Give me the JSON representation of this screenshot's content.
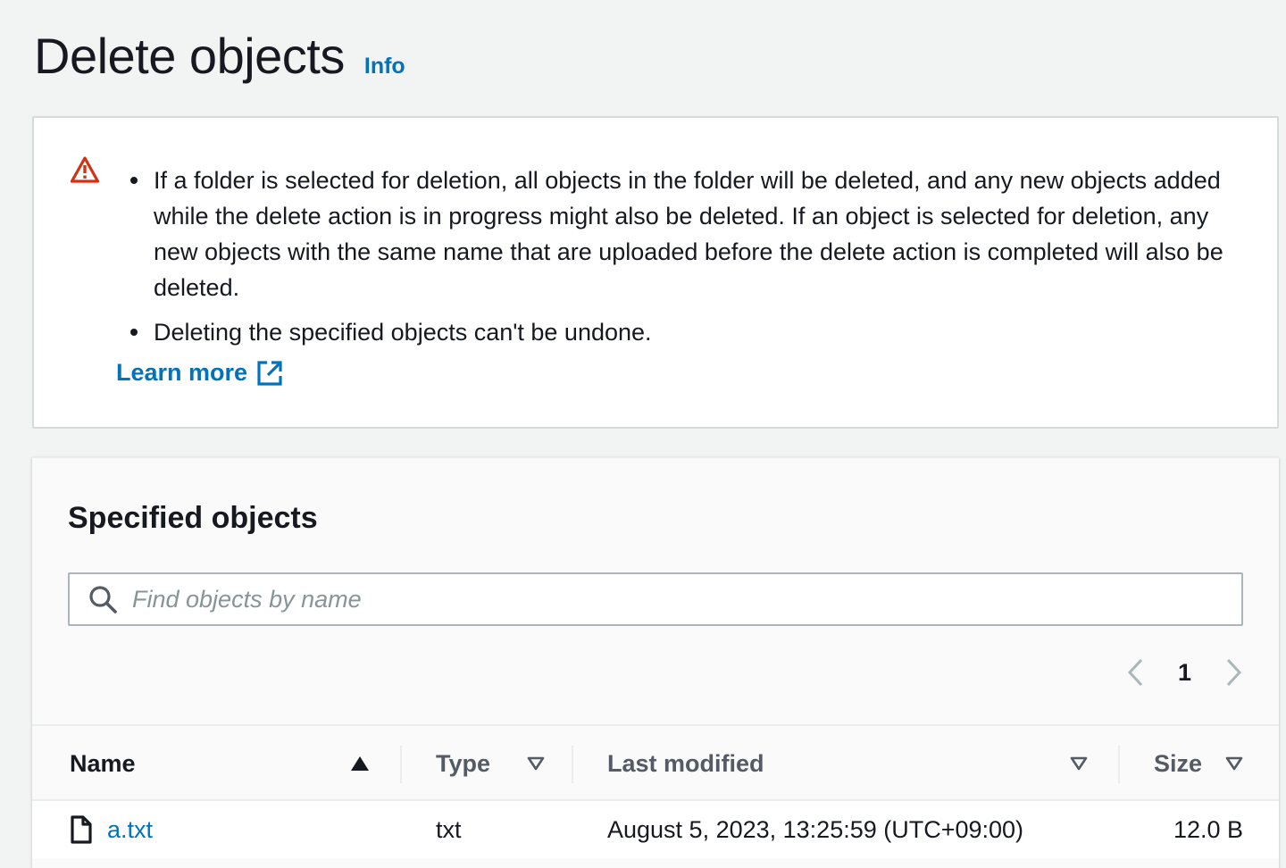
{
  "header": {
    "title": "Delete objects",
    "info_label": "Info"
  },
  "alert": {
    "icon": "warning-icon",
    "messages": [
      "If a folder is selected for deletion, all objects in the folder will be deleted, and any new objects added while the delete action is in progress might also be deleted. If an object is selected for deletion, any new objects with the same name that are uploaded before the delete action is completed will also be deleted.",
      "Deleting the specified objects can't be undone."
    ],
    "learn_more_label": "Learn more"
  },
  "panel": {
    "title": "Specified objects",
    "search": {
      "placeholder": "Find objects by name",
      "value": ""
    },
    "pagination": {
      "current_page": "1"
    },
    "table": {
      "columns": {
        "name": "Name",
        "type": "Type",
        "last_modified": "Last modified",
        "size": "Size"
      },
      "rows": [
        {
          "name": "a.txt",
          "type": "txt",
          "last_modified": "August 5, 2023, 13:25:59 (UTC+09:00)",
          "size": "12.0 B"
        }
      ]
    }
  },
  "colors": {
    "link": "#0073bb",
    "warning": "#d13212",
    "text": "#16191f",
    "background": "#f2f3f3"
  }
}
